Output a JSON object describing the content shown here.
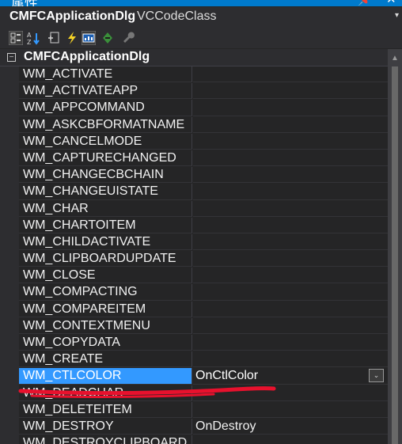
{
  "window": {
    "title": "属性",
    "pin_glyph": "📌",
    "close_glyph": "✕"
  },
  "classbar": {
    "name": "CMFCApplicationDlg",
    "class_type": "VCCodeClass",
    "dropdown_glyph": "▾"
  },
  "toolbar": {
    "buttons": [
      {
        "icon": "categorized-icon",
        "active": true
      },
      {
        "icon": "alphabetical-icon",
        "active": false
      },
      {
        "icon": "properties-icon",
        "active": false
      },
      {
        "icon": "events-icon",
        "active": false
      },
      {
        "icon": "messages-icon",
        "active": true
      },
      {
        "icon": "overrides-icon",
        "active": false
      },
      {
        "icon": "property-pages-icon",
        "active": false
      }
    ]
  },
  "grid": {
    "group_name": "CMFCApplicationDlg",
    "collapse_glyph": "−",
    "rows": [
      {
        "name": "WM_ACTIVATE",
        "value": ""
      },
      {
        "name": "WM_ACTIVATEAPP",
        "value": ""
      },
      {
        "name": "WM_APPCOMMAND",
        "value": ""
      },
      {
        "name": "WM_ASKCBFORMATNAME",
        "value": ""
      },
      {
        "name": "WM_CANCELMODE",
        "value": ""
      },
      {
        "name": "WM_CAPTURECHANGED",
        "value": ""
      },
      {
        "name": "WM_CHANGECBCHAIN",
        "value": ""
      },
      {
        "name": "WM_CHANGEUISTATE",
        "value": ""
      },
      {
        "name": "WM_CHAR",
        "value": ""
      },
      {
        "name": "WM_CHARTOITEM",
        "value": ""
      },
      {
        "name": "WM_CHILDACTIVATE",
        "value": ""
      },
      {
        "name": "WM_CLIPBOARDUPDATE",
        "value": ""
      },
      {
        "name": "WM_CLOSE",
        "value": ""
      },
      {
        "name": "WM_COMPACTING",
        "value": ""
      },
      {
        "name": "WM_COMPAREITEM",
        "value": ""
      },
      {
        "name": "WM_CONTEXTMENU",
        "value": ""
      },
      {
        "name": "WM_COPYDATA",
        "value": ""
      },
      {
        "name": "WM_CREATE",
        "value": ""
      },
      {
        "name": "WM_CTLCOLOR",
        "value": "OnCtlColor",
        "selected": true
      },
      {
        "name": "WM_DEADCHAR",
        "value": ""
      },
      {
        "name": "WM_DELETEITEM",
        "value": ""
      },
      {
        "name": "WM_DESTROY",
        "value": "OnDestroy"
      },
      {
        "name": "WM_DESTROYCLIPBOARD",
        "value": ""
      }
    ],
    "value_dropdown_glyph": "⌄"
  },
  "scrollbar": {
    "up_glyph": "▲"
  },
  "colors": {
    "accent": "#007acc",
    "selection": "#3399ff",
    "annotation": "#e8112d"
  }
}
